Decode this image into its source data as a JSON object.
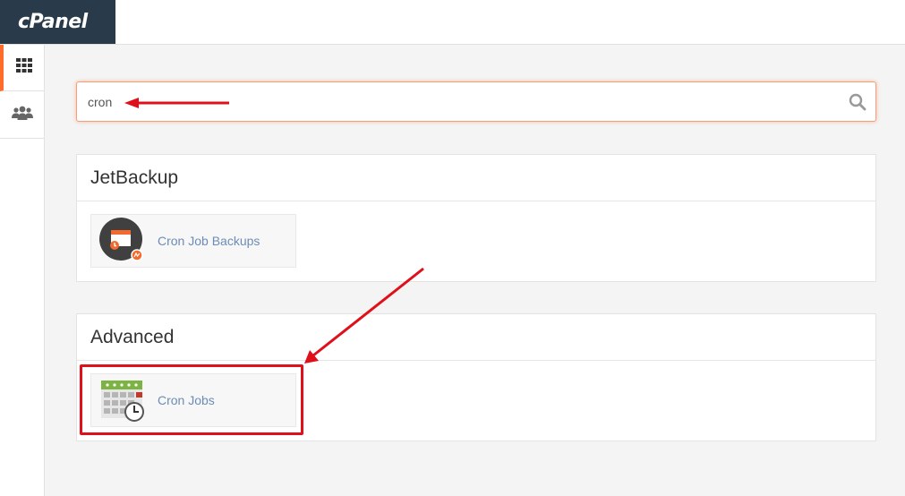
{
  "app": {
    "logo": "cPanel"
  },
  "sidebar": {
    "items": [
      {
        "name": "tools",
        "icon": "grid-icon",
        "active": true
      },
      {
        "name": "users",
        "icon": "users-icon",
        "active": false
      }
    ]
  },
  "search": {
    "value": "cron",
    "icon": "search-icon"
  },
  "sections": [
    {
      "title": "JetBackup",
      "items": [
        {
          "label": "Cron Job Backups",
          "icon": "cron-backup-icon"
        }
      ]
    },
    {
      "title": "Advanced",
      "items": [
        {
          "label": "Cron Jobs",
          "icon": "calendar-clock-icon"
        }
      ]
    }
  ],
  "colors": {
    "accent": "#ff6c2c",
    "annotation": "#e0101a",
    "link": "#6d8cb5",
    "logo_bg": "#293a4a"
  }
}
